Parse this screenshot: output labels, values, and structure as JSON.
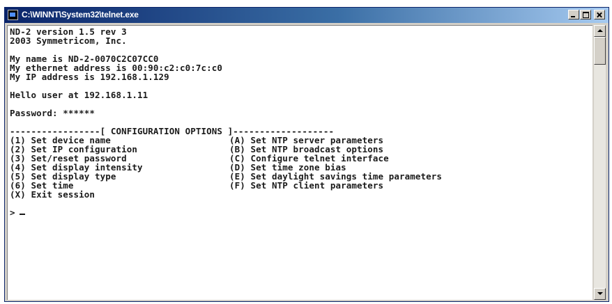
{
  "window": {
    "title": "C:\\WINNT\\System32\\telnet.exe",
    "icon": "console-app-icon",
    "controls": {
      "minimize": "minimize-icon",
      "maximize": "maximize-icon",
      "close": "close-icon"
    }
  },
  "console": {
    "header": [
      "ND-2 version 1.5 rev 3",
      "2003 Symmetricom, Inc."
    ],
    "identity": [
      "My name is ND-2-0070C2C07CC0",
      "My ethernet address is 00:90:c2:c0:7c:c0",
      "My IP address is 192.168.1.129"
    ],
    "greeting": "Hello user at 192.168.1.11",
    "password_line": "Password: ******",
    "menu_title": "-----------------[ CONFIGURATION OPTIONS ]-------------------",
    "menu_left": [
      "(1) Set device name",
      "(2) Set IP configuration",
      "(3) Set/reset password",
      "(4) Set display intensity",
      "(5) Set display type",
      "(6) Set time",
      "(X) Exit session"
    ],
    "menu_right": [
      "(A) Set NTP server parameters",
      "(B) Set NTP broadcast options",
      "(C) Configure telnet interface",
      "(D) Set time zone bias",
      "(E) Set daylight savings time parameters",
      "(F) Set NTP client parameters",
      ""
    ],
    "prompt": ">"
  }
}
